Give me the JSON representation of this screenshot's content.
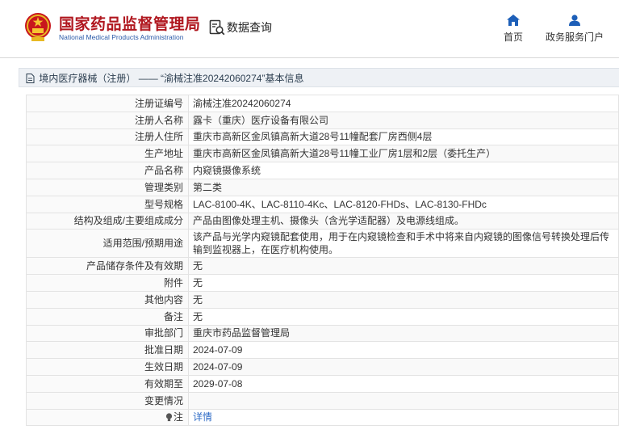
{
  "header": {
    "logo_cn": "国家药品监督管理局",
    "logo_en": "National Medical Products Administration",
    "query_label": "数据查询",
    "nav": {
      "home_label": "首页",
      "portal_label": "政务服务门户"
    }
  },
  "breadcrumb": {
    "category": "境内医疗器械（注册）",
    "separator": "——",
    "title": "“渝械注准20242060274”基本信息"
  },
  "record": {
    "rows": [
      {
        "label": "注册证编号",
        "value": "渝械注准20242060274"
      },
      {
        "label": "注册人名称",
        "value": "露卡（重庆）医疗设备有限公司"
      },
      {
        "label": "注册人住所",
        "value": "重庆市高新区金凤镇高新大道28号11幢配套厂房西侧4层"
      },
      {
        "label": "生产地址",
        "value": "重庆市高新区金凤镇高新大道28号11幢工业厂房1层和2层（委托生产）"
      },
      {
        "label": "产品名称",
        "value": "内窥镜摄像系统"
      },
      {
        "label": "管理类别",
        "value": "第二类"
      },
      {
        "label": "型号规格",
        "value": "LAC-8100-4K、LAC-8110-4Kc、LAC-8120-FHDs、LAC-8130-FHDc"
      },
      {
        "label": "结构及组成/主要组成成分",
        "value": "产品由图像处理主机、摄像头（含光学适配器）及电源线组成。"
      },
      {
        "label": "适用范围/预期用途",
        "value": "该产品与光学内窥镜配套使用，用于在内窥镜检查和手术中将来自内窥镜的图像信号转换处理后传输到监视器上，在医疗机构使用。"
      },
      {
        "label": "产品储存条件及有效期",
        "value": "无"
      },
      {
        "label": "附件",
        "value": "无"
      },
      {
        "label": "其他内容",
        "value": "无"
      },
      {
        "label": "备注",
        "value": "无"
      },
      {
        "label": "审批部门",
        "value": "重庆市药品监督管理局"
      },
      {
        "label": "批准日期",
        "value": "2024-07-09"
      },
      {
        "label": "生效日期",
        "value": "2024-07-09"
      },
      {
        "label": "有效期至",
        "value": "2029-07-08"
      },
      {
        "label": "变更情况",
        "value": ""
      }
    ],
    "note_label": "注",
    "note_link": "详情"
  },
  "colors": {
    "brand_red": "#b0171f",
    "brand_blue": "#2a5aa8",
    "link_blue": "#2e6bc6",
    "nav_icon_blue": "#1d5fb8"
  }
}
